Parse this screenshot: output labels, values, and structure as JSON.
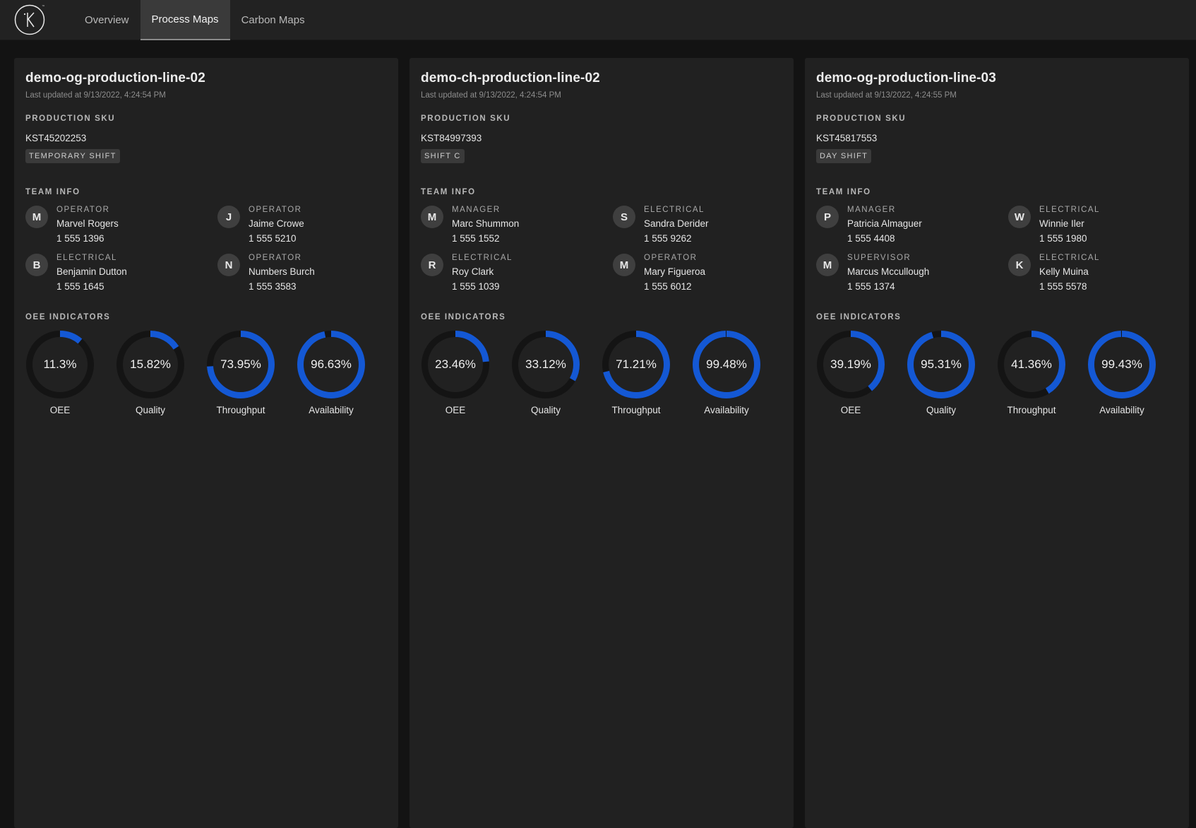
{
  "nav": {
    "logo_letter": "K",
    "tabs": [
      {
        "label": "Overview",
        "active": false
      },
      {
        "label": "Process Maps",
        "active": true
      },
      {
        "label": "Carbon Maps",
        "active": false
      }
    ]
  },
  "colors": {
    "accent": "#1458d4",
    "track": "#141414"
  },
  "labels": {
    "production_sku": "PRODUCTION SKU",
    "team_info": "TEAM INFO",
    "oee_indicators": "OEE INDICATORS"
  },
  "lines": [
    {
      "title": "demo-og-production-line-02",
      "updated": "Last updated at 9/13/2022, 4:24:54 PM",
      "sku": "KST45202253",
      "shift": "TEMPORARY SHIFT",
      "team": [
        {
          "initial": "M",
          "role": "OPERATOR",
          "name": "Marvel Rogers",
          "phone": "1 555 1396"
        },
        {
          "initial": "J",
          "role": "OPERATOR",
          "name": "Jaime Crowe",
          "phone": "1 555 5210"
        },
        {
          "initial": "B",
          "role": "ELECTRICAL",
          "name": "Benjamin Dutton",
          "phone": "1 555 1645"
        },
        {
          "initial": "N",
          "role": "OPERATOR",
          "name": "Numbers Burch",
          "phone": "1 555 3583"
        }
      ],
      "indicators": [
        {
          "name": "OEE",
          "value": 11.3,
          "label": "11.3%"
        },
        {
          "name": "Quality",
          "value": 15.82,
          "label": "15.82%"
        },
        {
          "name": "Throughput",
          "value": 73.95,
          "label": "73.95%"
        },
        {
          "name": "Availability",
          "value": 96.63,
          "label": "96.63%"
        }
      ]
    },
    {
      "title": "demo-ch-production-line-02",
      "updated": "Last updated at 9/13/2022, 4:24:54 PM",
      "sku": "KST84997393",
      "shift": "SHIFT C",
      "team": [
        {
          "initial": "M",
          "role": "MANAGER",
          "name": "Marc Shummon",
          "phone": "1 555 1552"
        },
        {
          "initial": "S",
          "role": "ELECTRICAL",
          "name": "Sandra Derider",
          "phone": "1 555 9262"
        },
        {
          "initial": "R",
          "role": "ELECTRICAL",
          "name": "Roy Clark",
          "phone": "1 555 1039"
        },
        {
          "initial": "M",
          "role": "OPERATOR",
          "name": "Mary Figueroa",
          "phone": "1 555 6012"
        }
      ],
      "indicators": [
        {
          "name": "OEE",
          "value": 23.46,
          "label": "23.46%"
        },
        {
          "name": "Quality",
          "value": 33.12,
          "label": "33.12%"
        },
        {
          "name": "Throughput",
          "value": 71.21,
          "label": "71.21%"
        },
        {
          "name": "Availability",
          "value": 99.48,
          "label": "99.48%"
        }
      ]
    },
    {
      "title": "demo-og-production-line-03",
      "updated": "Last updated at 9/13/2022, 4:24:55 PM",
      "sku": "KST45817553",
      "shift": "DAY SHIFT",
      "team": [
        {
          "initial": "P",
          "role": "MANAGER",
          "name": "Patricia Almaguer",
          "phone": "1 555 4408"
        },
        {
          "initial": "W",
          "role": "ELECTRICAL",
          "name": "Winnie Iler",
          "phone": "1 555 1980"
        },
        {
          "initial": "M",
          "role": "SUPERVISOR",
          "name": "Marcus Mccullough",
          "phone": "1 555 1374"
        },
        {
          "initial": "K",
          "role": "ELECTRICAL",
          "name": "Kelly Muina",
          "phone": "1 555 5578"
        }
      ],
      "indicators": [
        {
          "name": "OEE",
          "value": 39.19,
          "label": "39.19%"
        },
        {
          "name": "Quality",
          "value": 95.31,
          "label": "95.31%"
        },
        {
          "name": "Throughput",
          "value": 41.36,
          "label": "41.36%"
        },
        {
          "name": "Availability",
          "value": 99.43,
          "label": "99.43%"
        }
      ]
    }
  ]
}
